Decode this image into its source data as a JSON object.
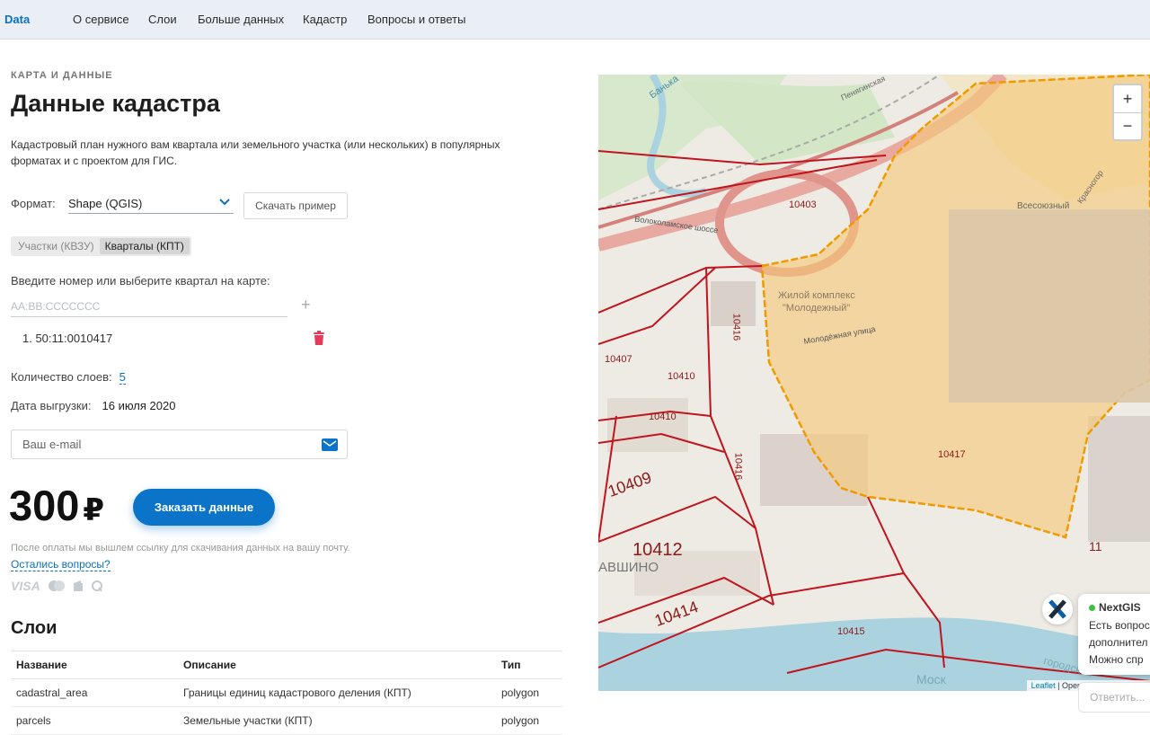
{
  "nav": {
    "logo": "Data",
    "links": [
      "О сервисе",
      "Слои",
      "Больше данных",
      "Кадастр",
      "Вопросы и ответы"
    ]
  },
  "header": {
    "overline": "КАРТА И ДАННЫЕ",
    "title": "Данные кадастра",
    "description": "Кадастровый план нужного вам квартала или земельного участка (или нескольких) в популярных форматах и с проектом для ГИС."
  },
  "format": {
    "label": "Формат:",
    "selected": "Shape (QGIS)",
    "sample_button": "Скачать пример"
  },
  "tabs": [
    {
      "label": "Участки (КВЗУ)",
      "active": false
    },
    {
      "label": "Кварталы (КПТ)",
      "active": true
    }
  ],
  "entry": {
    "label": "Введите номер или выберите квартал на карте:",
    "placeholder": "AA:BB:CCCCCCC",
    "items": [
      "1. 50:11:0010417"
    ]
  },
  "info": {
    "layers_label": "Количество слоев:",
    "layers_value": "5",
    "date_label": "Дата выгрузки:",
    "date_value": "16 июля 2020"
  },
  "email": {
    "placeholder": "Ваш e-mail"
  },
  "order": {
    "price": "300",
    "currency": "₽",
    "button": "Заказать данные",
    "after_pay": "После оплаты мы вышлем ссылку для скачивания данных на вашу почту.",
    "questions": "Остались вопросы?",
    "payment_methods": [
      "VISA"
    ]
  },
  "layers": {
    "title": "Слои",
    "columns": [
      "Название",
      "Описание",
      "Тип"
    ],
    "rows": [
      [
        "cadastral_area",
        "Границы единиц кадастрового деления (КПТ)",
        "polygon"
      ],
      [
        "parcels",
        "Земельные участки (КПТ)",
        "polygon"
      ]
    ]
  },
  "map": {
    "zoom_in": "+",
    "zoom_out": "−",
    "labels": {
      "l10403": "10403",
      "l10407": "10407",
      "l10410a": "10410",
      "l10410b": "10410",
      "l10416a": "10416",
      "l10416b": "10416",
      "l10409": "10409",
      "l10412": "10412",
      "l10414": "10414",
      "l10415": "10415",
      "l10417": "10417",
      "l11": "11",
      "complex": "Жилой комплекс",
      "complex2": "\"Молодежный\"",
      "street1": "Волоколамское шоссе",
      "street2": "Молодёжная улица",
      "river": "Банька",
      "district": "АВШИНО",
      "vsesoyuzny": "Всесоюзный",
      "penyag": "Пенягинская",
      "krasnogorsk": "Красногор",
      "moscow": "Моск",
      "gorodskoy": "городской"
    },
    "attribution_leaflet": "Leaflet",
    "attribution_rest": " | OpenStreetMap contrib"
  },
  "chat": {
    "name": "NextGIS",
    "lines": [
      "Есть вопрос",
      "дополнител",
      "Можно спр"
    ],
    "reply_placeholder": "Ответить..."
  },
  "colors": {
    "accent": "#0b74c8",
    "selection_fill": "#f5c878",
    "selection_border": "#f09a00",
    "cadastral_line": "#c0141e",
    "trash": "#e63a5c"
  }
}
